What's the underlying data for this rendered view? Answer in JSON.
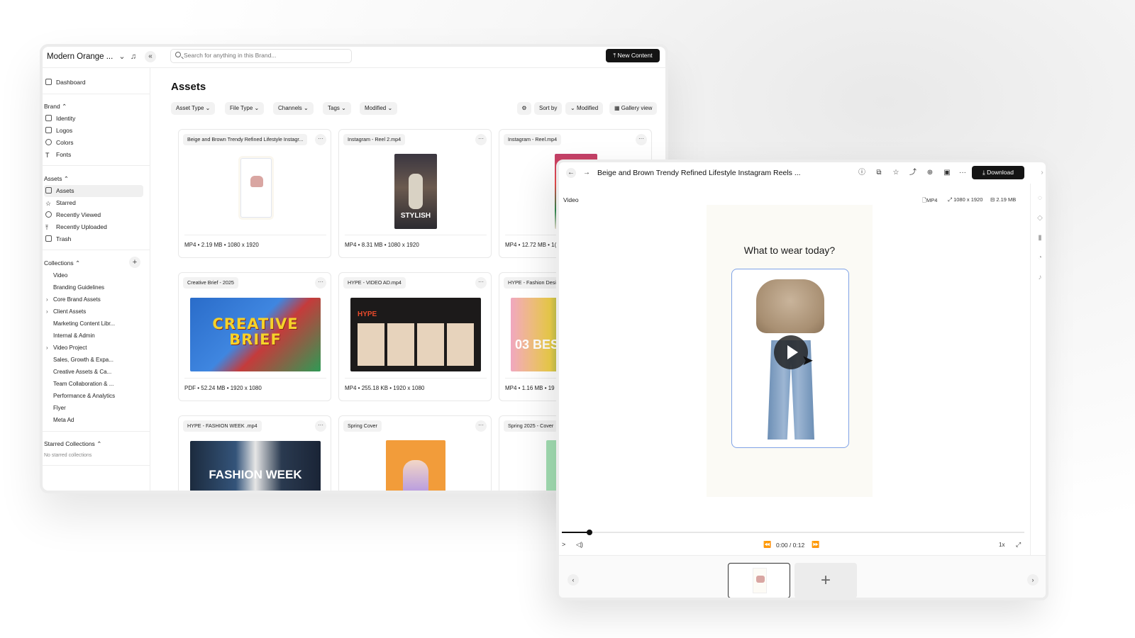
{
  "app": {
    "workspace_name": "Modern Orange ...",
    "search_placeholder": "Search for anything in this Brand...",
    "new_content_label": "New Content",
    "icons": [
      "chevron-down-icon",
      "bell-icon",
      "collapse-sidebar-icon",
      "search-icon",
      "upload-icon"
    ]
  },
  "sidebar": {
    "dashboard": "Dashboard",
    "brand_header": "Brand",
    "brand_items": [
      "Identity",
      "Logos",
      "Colors",
      "Fonts"
    ],
    "assets_header": "Assets",
    "assets_items": [
      "Assets",
      "Starred",
      "Recently Viewed",
      "Recently Uploaded",
      "Trash"
    ],
    "collections_header": "Collections",
    "collections": [
      "Video",
      "Branding Guidelines",
      "Core Brand Assets",
      "Client Assets",
      "Marketing Content Libr...",
      "Internal & Admin",
      "Video Project",
      "Sales, Growth & Expa...",
      "Creative Assets & Ca...",
      "Team Collaboration & ...",
      "Performance & Analytics",
      "Flyer",
      "Meta Ad"
    ],
    "starred_header": "Starred Collections",
    "starred_empty": "No starred collections"
  },
  "main": {
    "title": "Assets",
    "filters": [
      "Asset Type",
      "File Type",
      "Channels",
      "Tags",
      "Modified"
    ],
    "sort_label": "Sort by",
    "sort_value": "Modified",
    "view_label": "Gallery view",
    "cards": [
      {
        "title": "Beige and Brown Trendy Refined Lifestyle Instagr...",
        "meta": "MP4 • 2.19 MB • 1080 x 1920"
      },
      {
        "title": "Instagram - Reel 2.mp4",
        "meta": "MP4 • 8.31 MB • 1080 x 1920",
        "overlay": "STYLISH"
      },
      {
        "title": "Instagram - Reel.mp4",
        "meta": "MP4 • 12.72 MB • 1("
      },
      {
        "title": "Creative Brief - 2025",
        "meta": "PDF • 52.24 MB • 1920 x 1080",
        "overlay": "CREATIVE BRIEF"
      },
      {
        "title": "HYPE - VIDEO AD.mp4",
        "meta": "MP4 • 255.18 KB • 1920 x 1080",
        "overlay": "HYPE"
      },
      {
        "title": "HYPE - Fashion Desig",
        "meta": "MP4 • 1.16 MB • 19",
        "overlay": "03 BES"
      },
      {
        "title": "HYPE - FASHION WEEK .mp4",
        "meta": "",
        "overlay": "FASHION WEEK"
      },
      {
        "title": "Spring Cover",
        "meta": ""
      },
      {
        "title": "Spring 2025 - Cover",
        "meta": ""
      }
    ]
  },
  "viewer": {
    "title": "Beige and Brown Trendy Refined Lifestyle Instagram Reels ...",
    "download_label": "Download",
    "type_label": "Video",
    "badges": [
      "MP4",
      "1080 x 1920",
      "2.19 MB"
    ],
    "question": "What to wear today?",
    "time": "0:00 / 0:12",
    "speed": "1x",
    "progress_fraction": 0.06,
    "icons": [
      "back-arrow-icon",
      "forward-arrow-icon",
      "info-icon",
      "copy-icon",
      "star-icon",
      "share-icon",
      "add-icon",
      "image-icon",
      "more-icon",
      "download-icon"
    ]
  }
}
